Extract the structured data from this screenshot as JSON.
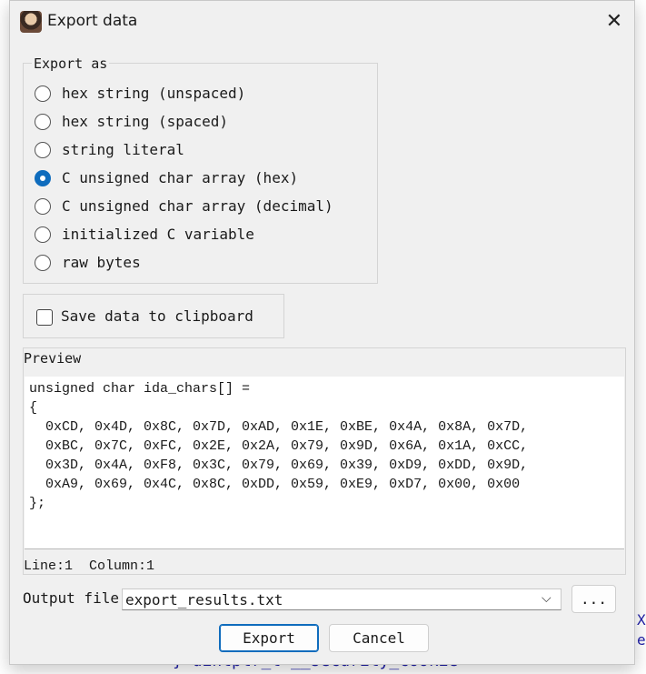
{
  "background": {
    "code_line": "} uintptr_t __security_cookie",
    "right_edge_1": "X",
    "right_edge_2": "e("
  },
  "dialog": {
    "title": "Export data",
    "close_glyph": "✕"
  },
  "export_as": {
    "legend": "Export as",
    "options": [
      {
        "label": "hex string (unspaced)",
        "checked": false
      },
      {
        "label": "hex string (spaced)",
        "checked": false
      },
      {
        "label": "string literal",
        "checked": false
      },
      {
        "label": "C unsigned char array (hex)",
        "checked": true
      },
      {
        "label": "C unsigned char array (decimal)",
        "checked": false
      },
      {
        "label": "initialized C variable",
        "checked": false
      },
      {
        "label": "raw bytes",
        "checked": false
      }
    ]
  },
  "clipboard": {
    "label": "Save data to clipboard",
    "checked": false
  },
  "preview": {
    "title": "Preview",
    "lines": [
      "unsigned char ida_chars[] =",
      "{",
      "  0xCD, 0x4D, 0x8C, 0x7D, 0xAD, 0x1E, 0xBE, 0x4A, 0x8A, 0x7D,",
      "  0xBC, 0x7C, 0xFC, 0x2E, 0x2A, 0x79, 0x9D, 0x6A, 0x1A, 0xCC,",
      "  0x3D, 0x4A, 0xF8, 0x3C, 0x79, 0x69, 0x39, 0xD9, 0xDD, 0x9D,",
      "  0xA9, 0x69, 0x4C, 0x8C, 0xDD, 0x59, 0xE9, 0xD7, 0x00, 0x00",
      "};"
    ],
    "status": "Line:1  Column:1"
  },
  "output": {
    "label": "Output file",
    "value": "export_results.txt",
    "browse_label": "..."
  },
  "buttons": {
    "export": "Export",
    "cancel": "Cancel"
  },
  "colors": {
    "accent": "#0f6cbd",
    "dialog_bg": "#f0f0f0"
  }
}
